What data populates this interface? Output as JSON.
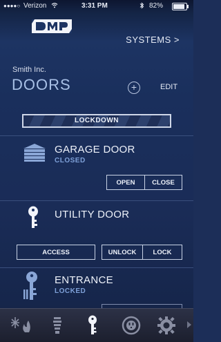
{
  "status_bar": {
    "signal_dots": "●●●●○",
    "carrier": "Verizon",
    "time": "3:31 PM",
    "battery_pct": "82%",
    "wifi_icon": "wifi-icon",
    "bluetooth_icon": "bluetooth-icon",
    "battery_level": 0.82
  },
  "header": {
    "logo_icon": "dmp-logo",
    "systems_label": "SYSTEMS >"
  },
  "page": {
    "company": "Smith Inc.",
    "title": "DOORS",
    "add_symbol": "+",
    "edit_label": "EDIT"
  },
  "lockdown": {
    "label": "LOCKDOWN"
  },
  "doors": [
    {
      "name": "GARAGE DOOR",
      "status": "CLOSED",
      "icon": "garage-door-icon",
      "buttons": [
        "OPEN",
        "CLOSE"
      ]
    },
    {
      "name": "UTILITY DOOR",
      "status": "",
      "icon": "key-icon",
      "buttons": [
        "ACCESS",
        "UNLOCK",
        "LOCK"
      ]
    },
    {
      "name": "ENTRANCE",
      "status": "LOCKED",
      "icon": "key-lock-icon",
      "buttons": []
    }
  ],
  "tabs": [
    {
      "icon": "thermostat-icon",
      "active": false
    },
    {
      "icon": "lightbulb-icon",
      "active": false
    },
    {
      "icon": "key-icon",
      "active": true
    },
    {
      "icon": "outlet-icon",
      "active": false
    },
    {
      "icon": "gear-icon",
      "active": false
    }
  ],
  "colors": {
    "accent_title": "#a8c0e6",
    "status_text": "#7ea0d8",
    "background": "#1a2f5c"
  }
}
